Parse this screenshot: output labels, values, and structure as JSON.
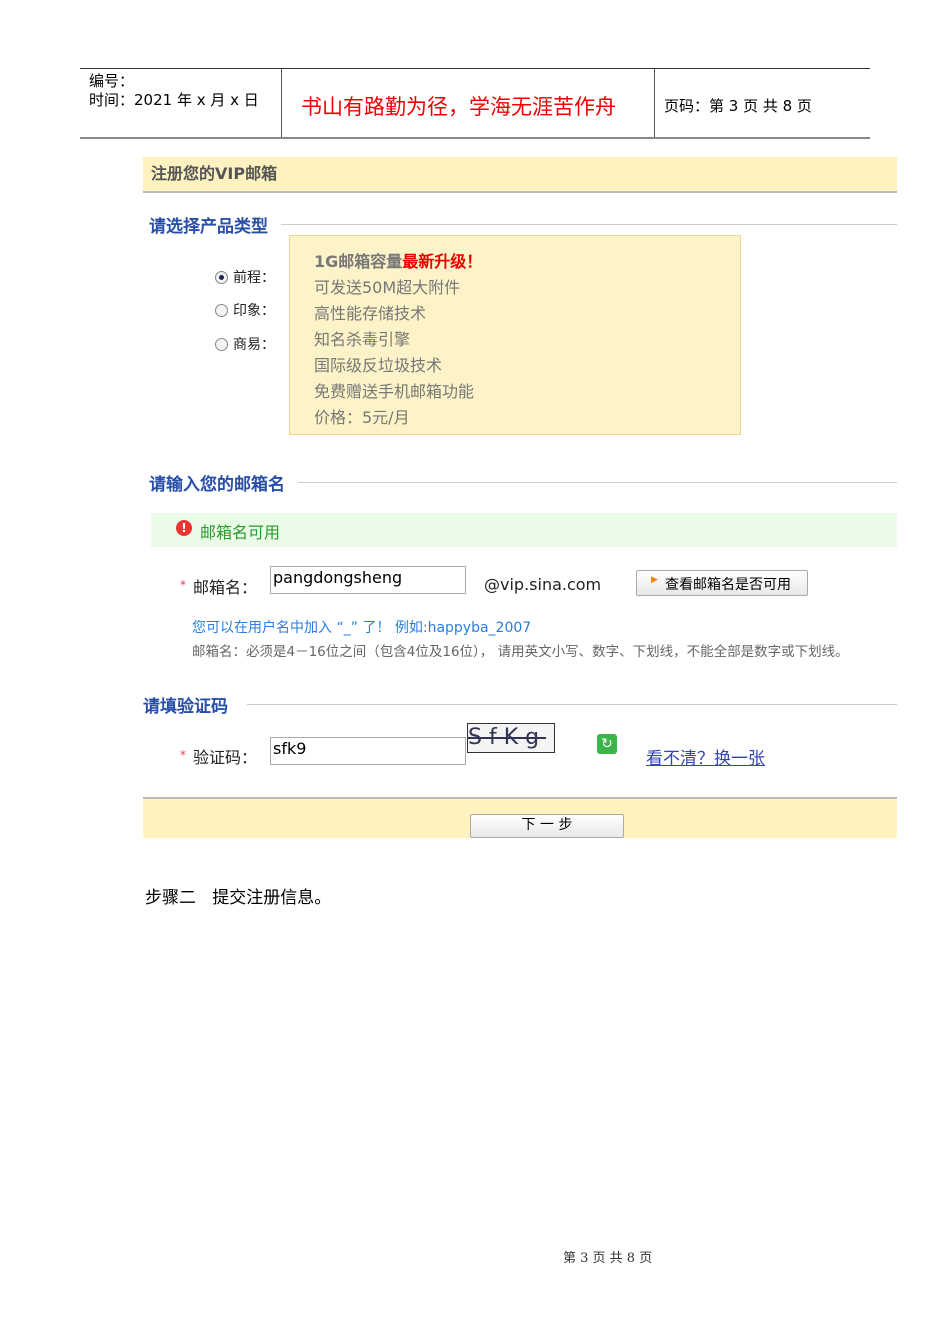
{
  "header": {
    "number_label": "编号：",
    "time_label": "时间：2021 年 x 月 x 日",
    "motto": "书山有路勤为径，学海无涯苦作舟",
    "page_label": "页码：第 3 页  共 8 页"
  },
  "form": {
    "title": "注册您的VIP邮箱",
    "product_section": "请选择产品类型",
    "options": [
      {
        "label": "前程：",
        "selected": true
      },
      {
        "label": "印象：",
        "selected": false
      },
      {
        "label": "商易：",
        "selected": false
      }
    ],
    "tip": {
      "capacity": "1G邮箱容量",
      "upgrade": "最新升级！",
      "lines": [
        "可发送50M超大附件",
        "高性能存储技术",
        "知名杀毒引擎",
        "国际级反垃圾技术",
        "免费赠送手机邮箱功能",
        "价格：5元/月"
      ]
    },
    "email_section": "请输入您的邮箱名",
    "status": "邮箱名可用",
    "email_label": "邮箱名：",
    "email_value": "pangdongsheng",
    "domain": "@vip.sina.com",
    "check_button": "查看邮箱名是否可用",
    "hint": "您可以在用户名中加入 “_” 了！ 例如:happyba_2007",
    "rule": "邮箱名：必须是4－16位之间（包含4位及16位）， 请用英文小写、数字、下划线，不能全部是数字或下划线。",
    "captcha_section": "请填验证码",
    "captcha_label": "验证码：",
    "captcha_value": "sfk9",
    "captcha_image_text": "SfKg",
    "refresh_link": "看不清？换一张",
    "next_button": "下 一 步"
  },
  "step_text": "步骤二   提交注册信息。",
  "footer": "第 3 页 共 8 页"
}
